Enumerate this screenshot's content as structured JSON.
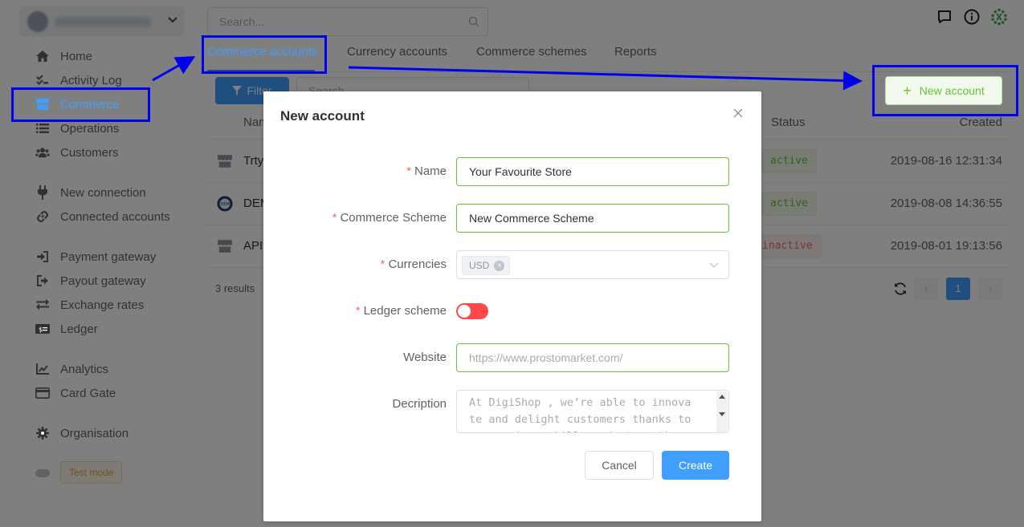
{
  "topbar": {
    "search_placeholder": "Search..."
  },
  "sidebar": {
    "items": [
      {
        "label": "Home",
        "icon": "home-icon"
      },
      {
        "label": "Activity Log",
        "icon": "checklist-icon"
      },
      {
        "label": "Commerce",
        "icon": "store-icon",
        "active": true
      },
      {
        "label": "Operations",
        "icon": "list-icon"
      },
      {
        "label": "Customers",
        "icon": "users-icon"
      },
      {
        "label": "New connection",
        "icon": "plug-icon"
      },
      {
        "label": "Connected accounts",
        "icon": "link-icon"
      },
      {
        "label": "Payment gateway",
        "icon": "sign-in-icon"
      },
      {
        "label": "Payout gateway",
        "icon": "sign-out-icon"
      },
      {
        "label": "Exchange rates",
        "icon": "exchange-icon"
      },
      {
        "label": "Ledger",
        "icon": "money-icon"
      },
      {
        "label": "Analytics",
        "icon": "chart-icon"
      },
      {
        "label": "Card Gate",
        "icon": "card-icon"
      },
      {
        "label": "Organisation",
        "icon": "gear-icon"
      }
    ],
    "test_mode_label": "Test mode"
  },
  "tabs": [
    {
      "label": "Commerce accounts",
      "active": true
    },
    {
      "label": "Currency accounts"
    },
    {
      "label": "Commerce schemes"
    },
    {
      "label": "Reports"
    }
  ],
  "toolbar": {
    "filter_label": "Filter",
    "search_placeholder": "Search...",
    "new_account_label": "New account"
  },
  "table": {
    "headers": {
      "name": "Name",
      "status": "Status",
      "created": "Created"
    },
    "rows": [
      {
        "name": "Trty",
        "status": "active",
        "created": "2019-08-16 12:31:34"
      },
      {
        "name": "DEM",
        "status": "active",
        "created": "2019-08-08 14:36:55"
      },
      {
        "name": "API",
        "status": "inactive",
        "created": "2019-08-01 19:13:56"
      }
    ],
    "results_text": "3 results",
    "current_page": "1"
  },
  "modal": {
    "title": "New account",
    "fields": {
      "name": {
        "label": "Name",
        "value": "Your Favourite Store"
      },
      "scheme": {
        "label": "Commerce Scheme",
        "value": "New Commerce Scheme"
      },
      "currencies": {
        "label": "Currencies",
        "selected": [
          "USD"
        ]
      },
      "ledger": {
        "label": "Ledger scheme",
        "enabled": false
      },
      "website": {
        "label": "Website",
        "placeholder": "https://www.prostomarket.com/"
      },
      "description": {
        "label": "Decription",
        "placeholder": "At DigiShop , we’re able to innova\nte and delight customers thanks to\n our unique skills and strengths."
      }
    },
    "cancel_label": "Cancel",
    "create_label": "Create"
  },
  "colors": {
    "primary": "#409eff",
    "success": "#67c23a",
    "danger": "#f56c6c",
    "annotation": "#0000ee"
  }
}
